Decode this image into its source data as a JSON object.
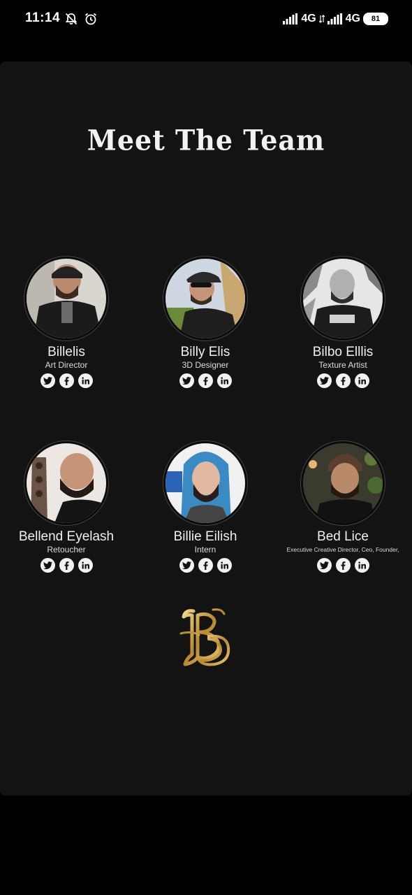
{
  "status_bar": {
    "time": "11:14",
    "network_1": "4G",
    "network_2": "4G",
    "battery": "81",
    "icons": [
      "notifications-off-icon",
      "alarm-icon",
      "signal-icon",
      "signal-icon",
      "battery-icon"
    ]
  },
  "page": {
    "title": "Meet The Team"
  },
  "team": [
    {
      "name": "Billelis",
      "role": "Art Director",
      "socials": [
        "twitter-icon",
        "facebook-icon",
        "linkedin-icon"
      ]
    },
    {
      "name": "Billy Elis",
      "role": "3D Designer",
      "socials": [
        "twitter-icon",
        "facebook-icon",
        "linkedin-icon"
      ]
    },
    {
      "name": "Bilbo Elllis",
      "role": "Texture Artist",
      "socials": [
        "twitter-icon",
        "facebook-icon",
        "linkedin-icon"
      ]
    },
    {
      "name": "Bellend Eyelash",
      "role": "Retoucher",
      "socials": [
        "twitter-icon",
        "facebook-icon",
        "linkedin-icon"
      ]
    },
    {
      "name": "Billie Eilish",
      "role": "Intern",
      "socials": [
        "twitter-icon",
        "facebook-icon",
        "linkedin-icon"
      ]
    },
    {
      "name": "Bed Lice",
      "role": "Executive Creative Director, Ceo, Founder,",
      "socials": [
        "twitter-icon",
        "facebook-icon",
        "linkedin-icon"
      ]
    }
  ],
  "colors": {
    "background": "#000000",
    "card": "#131313",
    "text": "#f0f0f0",
    "social_bg": "#f2f2f2",
    "logo_gold": "#c9a14a"
  },
  "logo": {
    "name": "monogram-logo"
  }
}
